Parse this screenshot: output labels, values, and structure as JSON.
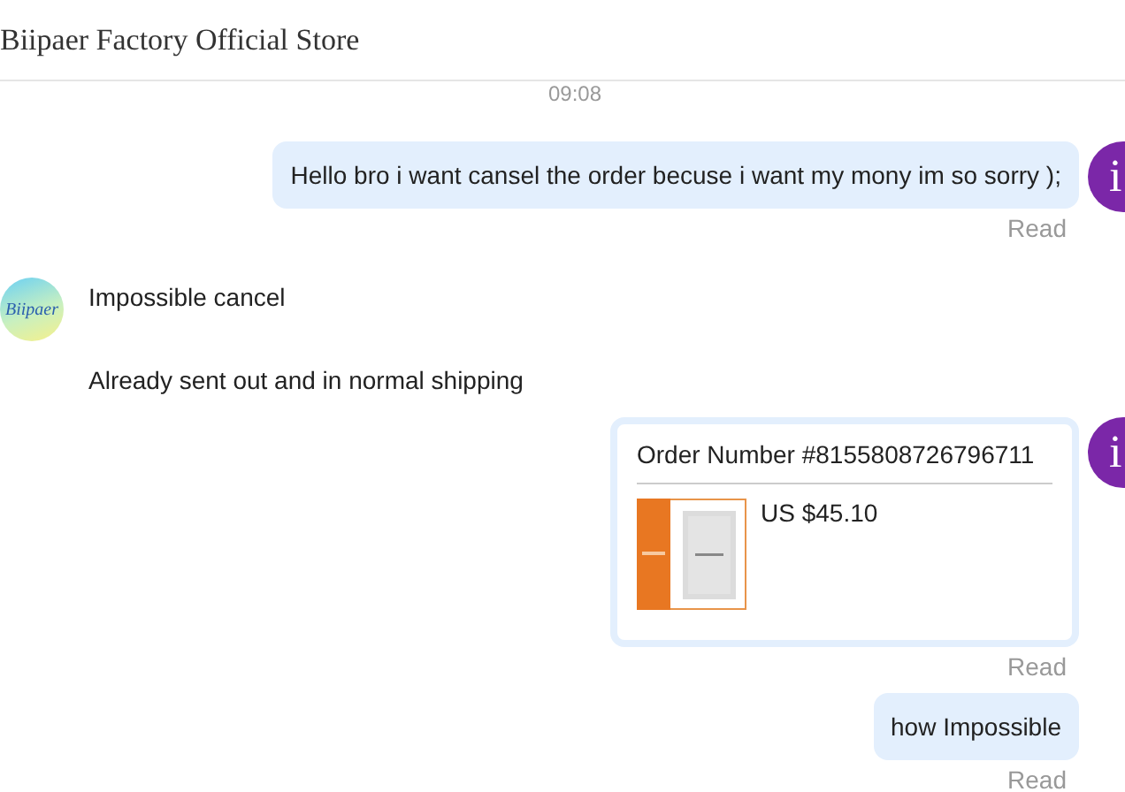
{
  "header": {
    "title": "Biipaer Factory Official Store"
  },
  "timestamp": "09:08",
  "messages": [
    {
      "kind": "text",
      "outgoing": true,
      "avatar_initial": "i",
      "text": "Hello bro i want cansel the order becuse i want my mony im so sorry );",
      "status": "Read"
    },
    {
      "kind": "text_group",
      "outgoing": false,
      "avatar_label": "Biipaer",
      "texts": [
        "Impossible cancel",
        "Already sent out and in normal shipping"
      ]
    },
    {
      "kind": "order",
      "outgoing": true,
      "avatar_initial": "i",
      "order_number": "Order Number #8155808726796711",
      "price": "US $45.10",
      "status": "Read"
    },
    {
      "kind": "text",
      "outgoing": true,
      "text": "how Impossible",
      "status": "Read"
    }
  ]
}
